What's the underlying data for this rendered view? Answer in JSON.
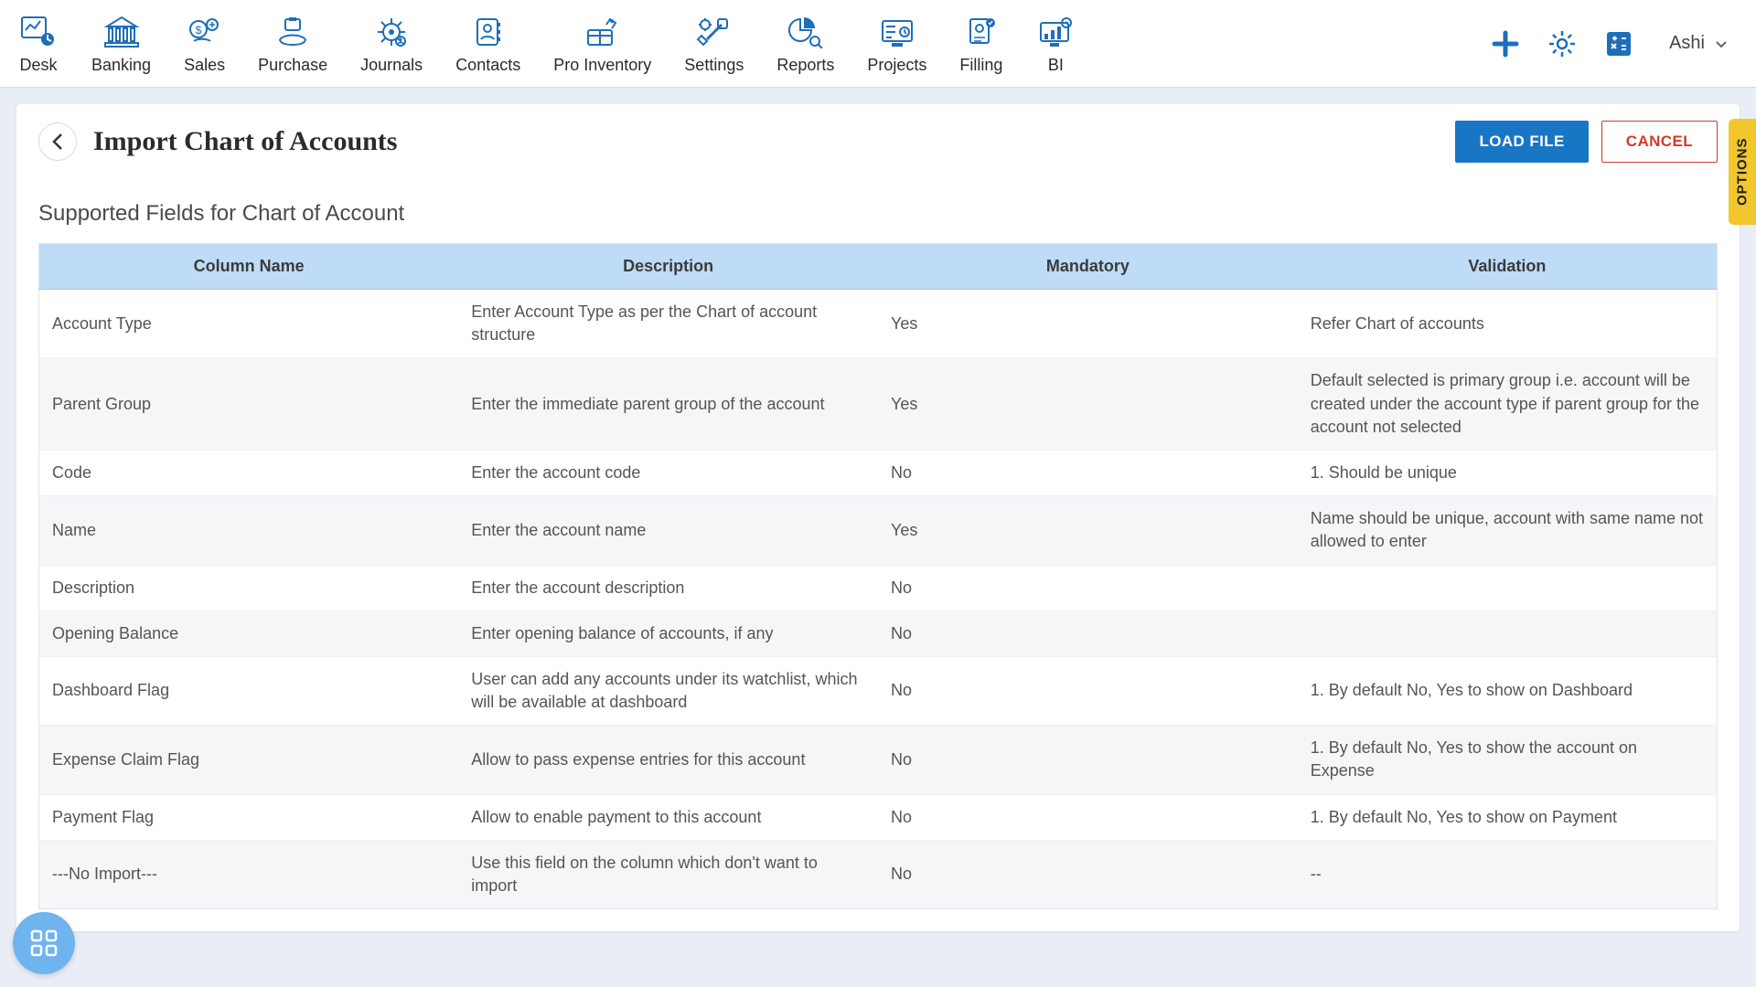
{
  "nav": {
    "items": [
      {
        "label": "Desk"
      },
      {
        "label": "Banking"
      },
      {
        "label": "Sales"
      },
      {
        "label": "Purchase"
      },
      {
        "label": "Journals"
      },
      {
        "label": "Contacts"
      },
      {
        "label": "Pro Inventory"
      },
      {
        "label": "Settings"
      },
      {
        "label": "Reports"
      },
      {
        "label": "Projects"
      },
      {
        "label": "Filling"
      },
      {
        "label": "BI"
      }
    ],
    "user": "Ashi"
  },
  "page": {
    "title": "Import Chart of Accounts",
    "load_file_label": "LOAD FILE",
    "cancel_label": "CANCEL",
    "options_label": "OPTIONS",
    "subheading": "Supported Fields for Chart of Account"
  },
  "table": {
    "headers": [
      "Column Name",
      "Description",
      "Mandatory",
      "Validation"
    ],
    "rows": [
      {
        "c0": "Account Type",
        "c1": "Enter Account Type as per the Chart of account structure",
        "c2": "Yes",
        "c3": "Refer Chart of accounts"
      },
      {
        "c0": "Parent Group",
        "c1": "Enter the immediate parent group of the account",
        "c2": "Yes",
        "c3": "Default selected is primary group i.e. account will be created under the account type if parent group for the account not selected"
      },
      {
        "c0": "Code",
        "c1": "Enter the account code",
        "c2": "No",
        "c3": "1. Should be unique"
      },
      {
        "c0": "Name",
        "c1": "Enter the account name",
        "c2": "Yes",
        "c3": "Name should be unique, account with same name not allowed to enter"
      },
      {
        "c0": "Description",
        "c1": "Enter the account description",
        "c2": "No",
        "c3": ""
      },
      {
        "c0": "Opening Balance",
        "c1": "Enter opening balance of accounts, if any",
        "c2": "No",
        "c3": ""
      },
      {
        "c0": "Dashboard Flag",
        "c1": "User can add any accounts under its watchlist, which will be available at dashboard",
        "c2": "No",
        "c3": "1. By default No, Yes to show on Dashboard"
      },
      {
        "c0": "Expense Claim Flag",
        "c1": "Allow to pass expense entries for this account",
        "c2": "No",
        "c3": "1. By default No, Yes to show the account on Expense"
      },
      {
        "c0": "Payment Flag",
        "c1": "Allow to enable payment to this account",
        "c2": "No",
        "c3": "1. By default No, Yes to show on Payment"
      },
      {
        "c0": "---No Import---",
        "c1": "Use this field on the column which don't want to import",
        "c2": "No",
        "c3": "--"
      }
    ]
  }
}
